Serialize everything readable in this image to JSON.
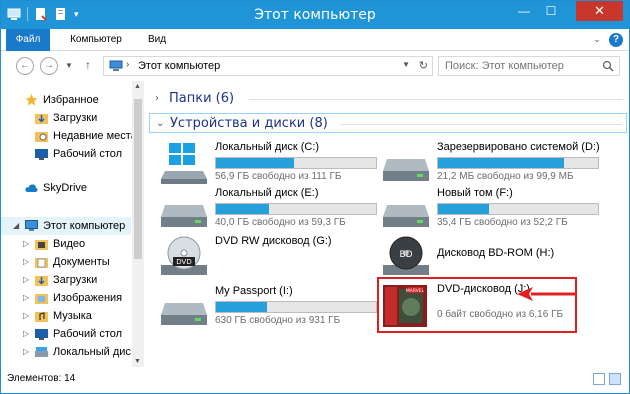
{
  "window": {
    "title": "Этот компьютер",
    "controls": {
      "minimize": "—",
      "maximize": "☐",
      "close": "✕"
    }
  },
  "ribbon": {
    "tabs": [
      {
        "label": "Файл"
      },
      {
        "label": "Компьютер"
      },
      {
        "label": "Вид"
      }
    ],
    "help": "?"
  },
  "navigation": {
    "breadcrumb": "Этот компьютер",
    "search_placeholder": "Поиск: Этот компьютер"
  },
  "sidebar": {
    "favorites": {
      "label": "Избранное",
      "items": [
        {
          "label": "Загрузки",
          "icon": "downloads-icon"
        },
        {
          "label": "Недавние места",
          "icon": "recent-places-icon"
        },
        {
          "label": "Рабочий стол",
          "icon": "desktop-icon"
        }
      ]
    },
    "skydrive": {
      "label": "SkyDrive"
    },
    "this_pc": {
      "label": "Этот компьютер",
      "items": [
        {
          "label": "Видео",
          "icon": "videos-folder-icon"
        },
        {
          "label": "Документы",
          "icon": "documents-folder-icon"
        },
        {
          "label": "Загрузки",
          "icon": "downloads-folder-icon"
        },
        {
          "label": "Изображения",
          "icon": "pictures-folder-icon"
        },
        {
          "label": "Музыка",
          "icon": "music-folder-icon"
        },
        {
          "label": "Рабочий стол",
          "icon": "desktop-folder-icon"
        },
        {
          "label": "Локальный диск",
          "icon": "local-disk-icon"
        }
      ]
    }
  },
  "content": {
    "groups": [
      {
        "title": "Папки (6)",
        "collapsed": true
      },
      {
        "title": "Устройства и диски (8)",
        "collapsed": false
      }
    ],
    "drives": [
      {
        "name": "Локальный диск (C:)",
        "free": "56,9 ГБ свободно из 111 ГБ",
        "used_fraction": 0.49,
        "icon": "windows-drive-icon"
      },
      {
        "name": "Зарезервировано системой (D:)",
        "free": "21,2 МБ свободно из 99,9 МБ",
        "used_fraction": 0.79,
        "icon": "hard-drive-icon"
      },
      {
        "name": "Локальный диск (E:)",
        "free": "40,0 ГБ свободно из 59,3 ГБ",
        "used_fraction": 0.33,
        "icon": "hard-drive-icon"
      },
      {
        "name": "Новый том (F:)",
        "free": "35,4 ГБ свободно из 52,2 ГБ",
        "used_fraction": 0.32,
        "icon": "hard-drive-icon"
      },
      {
        "name": "DVD RW дисковод (G:)",
        "free": "",
        "icon": "dvd-rw-icon"
      },
      {
        "name": "Дисковод BD-ROM (H:)",
        "free": "",
        "icon": "bd-rom-icon"
      },
      {
        "name": "My Passport (I:)",
        "free": "630 ГБ свободно из 931 ГБ",
        "used_fraction": 0.32,
        "icon": "hard-drive-icon"
      },
      {
        "name": "DVD-дисковод (J:)",
        "free": "0 байт свободно из 6,16 ГБ",
        "used_fraction": 1.0,
        "icon": "dvd-disc-marvel-icon"
      }
    ]
  },
  "statusbar": {
    "items_count": "Элементов: 14"
  },
  "colors": {
    "titlebar": "#1f95d8",
    "file_tab": "#1979ca",
    "progress": "#26a0da",
    "highlight": "#e02020"
  }
}
